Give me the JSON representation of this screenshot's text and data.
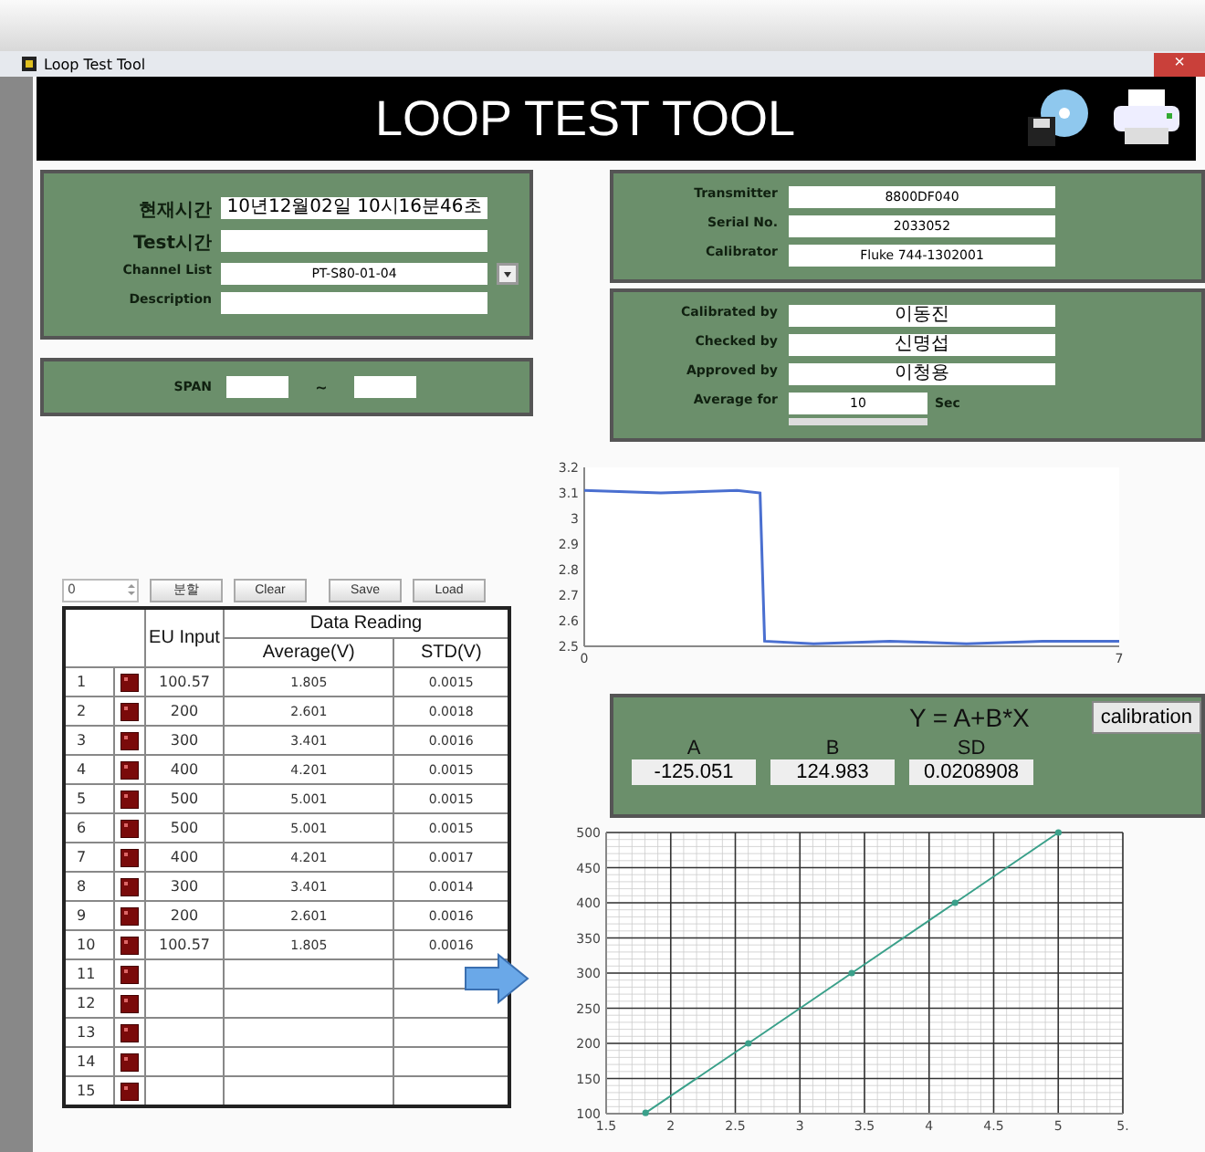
{
  "window": {
    "title": "Loop Test Tool",
    "close_glyph": "×"
  },
  "header": {
    "title": "LOOP TEST TOOL"
  },
  "info_panel": {
    "fields": [
      {
        "label": "현재시간",
        "value": "10년12월02일 10시16분46초",
        "kind": "text"
      },
      {
        "label": "Test시간",
        "kind": "text"
      },
      {
        "label": "Channel List",
        "value": "PT-S80-01-04",
        "kind": "dropdown"
      },
      {
        "label": "Description",
        "kind": "text"
      }
    ]
  },
  "span_panel": {
    "label": "SPAN",
    "separator": "~"
  },
  "device_panel": {
    "fields": [
      {
        "label": "Transmitter",
        "value": "8800DF040"
      },
      {
        "label": "Serial No.",
        "value": "2033052"
      },
      {
        "label": "Calibrator",
        "value": "Fluke 744-1302001"
      }
    ]
  },
  "people_panel": {
    "fields": [
      {
        "label": "Calibrated by",
        "value": "이동진"
      },
      {
        "label": "Checked by",
        "value": "신명섭"
      },
      {
        "label": "Approved by",
        "value": "이청용"
      }
    ],
    "average": {
      "label": "Average for",
      "value": "10",
      "unit": "Sec"
    },
    "progress": {
      "level": 0
    }
  },
  "toolbar": {
    "spinner": "0",
    "buttons": [
      "분할",
      "Clear",
      "Save",
      "Load"
    ]
  },
  "table": {
    "columns": {
      "eu": "EU Input",
      "group": "Data Reading",
      "average": "Average(V)",
      "std": "STD(V)"
    },
    "rows": [
      {
        "no": "1",
        "eu": "100.57",
        "average": "1.805",
        "std": "0.0015"
      },
      {
        "no": "2",
        "eu": "200",
        "average": "2.601",
        "std": "0.0018"
      },
      {
        "no": "3",
        "eu": "300",
        "average": "3.401",
        "std": "0.0016"
      },
      {
        "no": "4",
        "eu": "400",
        "average": "4.201",
        "std": "0.0015"
      },
      {
        "no": "5",
        "eu": "500",
        "average": "5.001",
        "std": "0.0015"
      },
      {
        "no": "6",
        "eu": "500",
        "average": "5.001",
        "std": "0.0015"
      },
      {
        "no": "7",
        "eu": "400",
        "average": "4.201",
        "std": "0.0017"
      },
      {
        "no": "8",
        "eu": "300",
        "average": "3.401",
        "std": "0.0014"
      },
      {
        "no": "9",
        "eu": "200",
        "average": "2.601",
        "std": "0.0016"
      },
      {
        "no": "10",
        "eu": "100.57",
        "average": "1.805",
        "std": "0.0016"
      },
      {
        "no": "11"
      },
      {
        "no": "12"
      },
      {
        "no": "13"
      },
      {
        "no": "14"
      },
      {
        "no": "15"
      }
    ]
  },
  "signal_chart": {
    "chart_data": {
      "type": "line",
      "x": [
        0,
        1,
        2,
        2.3,
        2.36,
        3,
        4,
        5,
        6,
        7
      ],
      "xlim": [
        0,
        7
      ],
      "ylim": [
        2.5,
        3.2
      ],
      "xticks": [
        0,
        7
      ],
      "yticks": [
        2.5,
        2.6,
        2.7,
        2.8,
        2.9,
        3,
        3.1,
        3.2
      ],
      "series": [
        {
          "color": "#4a6fd0",
          "values": [
            3.11,
            3.1,
            3.11,
            3.1,
            2.52,
            2.51,
            2.52,
            2.51,
            2.52,
            2.52
          ]
        }
      ]
    }
  },
  "equation": {
    "formula": "Y = A+B*X",
    "button": "calibration",
    "coefficients": [
      {
        "label": "A",
        "value": "-125.051"
      },
      {
        "label": "B",
        "value": "124.983"
      },
      {
        "label": "SD",
        "value": "0.0208908"
      }
    ]
  },
  "fit_chart": {
    "chart_data": {
      "type": "line",
      "grid": true,
      "x": [
        1.805,
        2.601,
        3.401,
        4.201,
        5.001
      ],
      "xlim": [
        1.5,
        5.5
      ],
      "ylim": [
        100,
        500
      ],
      "xticks": [
        1.5,
        2,
        2.5,
        3,
        3.5,
        4,
        4.5,
        5,
        {
          "value": 5.5,
          "label": "5."
        }
      ],
      "yticks": [
        100,
        150,
        200,
        250,
        300,
        350,
        400,
        450,
        500
      ],
      "series": [
        {
          "color": "#3aa08a",
          "values": [
            101,
            200,
            300,
            400,
            500
          ]
        }
      ]
    }
  }
}
